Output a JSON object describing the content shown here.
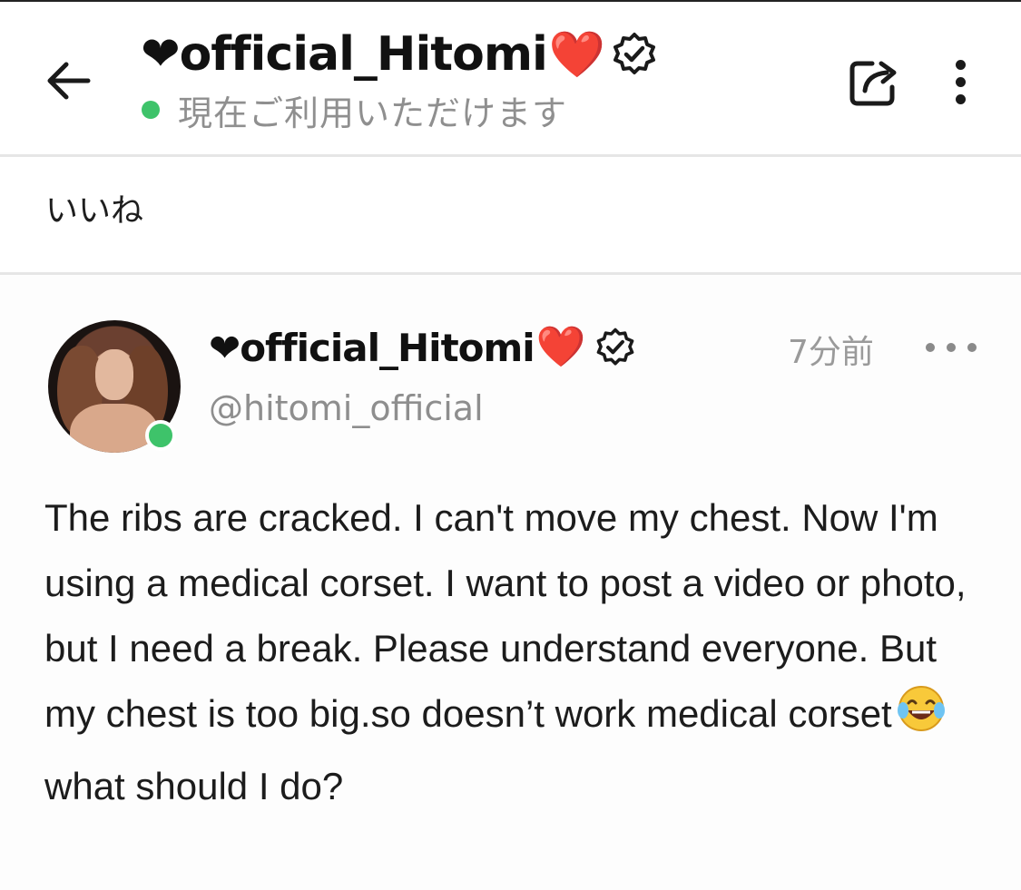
{
  "header": {
    "name": "official_Hitomi",
    "name_prefix_heart": "❤",
    "red_heart": "❤️",
    "status": "現在ご利用いただけます",
    "status_color": "#3ec36a",
    "icons": [
      "back-arrow-icon",
      "verified-badge-icon",
      "share-icon",
      "more-vertical-icon"
    ]
  },
  "likes": {
    "label": "いいね"
  },
  "post": {
    "display_name": "official_Hitomi",
    "name_prefix_heart": "❤",
    "red_heart": "❤️",
    "handle": "@hitomi_official",
    "time": "7分前",
    "text_part1": "The ribs are cracked. I can't move my chest. Now I'm using a medical corset. I want to post a video or photo, but I need a break. Please understand everyone. But my chest is too big.so doesn’t work medical corset",
    "emoji": "😂",
    "text_part2": " what should I do?",
    "online": true,
    "icons": [
      "verified-badge-icon",
      "more-horizontal-icon",
      "laughing-crying-emoji-icon"
    ]
  },
  "colors": {
    "heart": "#e0262e",
    "online": "#3ec36a",
    "muted_text": "#8e8e8e"
  }
}
